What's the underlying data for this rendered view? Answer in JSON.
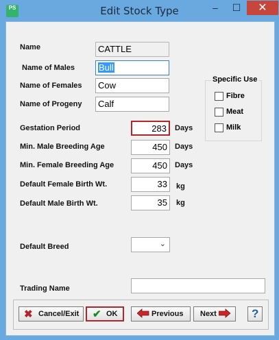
{
  "window": {
    "title": "Edit Stock Type",
    "icon_text": "PS"
  },
  "titlebar_buttons": {
    "minimize": "–",
    "maximize": "☐",
    "close": "✕"
  },
  "form": {
    "name_label": "Name",
    "name_value": "CATTLE",
    "males_label": "Name of Males",
    "males_value": "Bull",
    "females_label": "Name of Females",
    "females_value": "Cow",
    "progeny_label": "Name of Progeny",
    "progeny_value": "Calf",
    "gestation_label": "Gestation Period",
    "gestation_value": "283",
    "gestation_unit": "Days",
    "male_breed_age_label": "Min. Male Breeding Age",
    "male_breed_age_value": "450",
    "male_breed_age_unit": "Days",
    "female_breed_age_label": "Min. Female Breeding Age",
    "female_breed_age_value": "450",
    "female_breed_age_unit": "Days",
    "female_birth_wt_label": "Default Female Birth Wt.",
    "female_birth_wt_value": "33",
    "female_birth_wt_unit": "kg",
    "male_birth_wt_label": "Default Male Birth Wt.",
    "male_birth_wt_value": "35",
    "male_birth_wt_unit": "kg",
    "default_breed_label": "Default Breed",
    "default_breed_value": "",
    "trading_name_label": "Trading Name",
    "trading_name_value": ""
  },
  "specific_use": {
    "title": "Specific Use",
    "options": [
      {
        "label": "Fibre",
        "checked": false
      },
      {
        "label": "Meat",
        "checked": false
      },
      {
        "label": "Milk",
        "checked": false
      }
    ]
  },
  "buttons": {
    "cancel": "Cancel/Exit",
    "ok": "OK",
    "previous": "Previous",
    "next": "Next",
    "help": "?"
  }
}
